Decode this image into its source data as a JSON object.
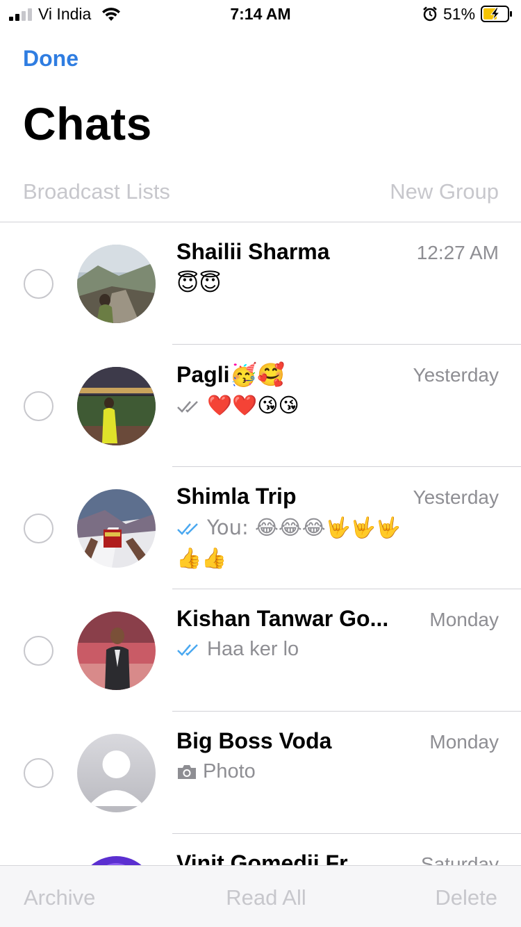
{
  "status_bar": {
    "carrier": "Vi India",
    "time": "7:14 AM",
    "battery_percent": "51%",
    "icons": [
      "signal-icon",
      "wifi-icon",
      "alarm-icon",
      "battery-charging-icon"
    ]
  },
  "header": {
    "done_label": "Done",
    "title": "Chats",
    "broadcast_label": "Broadcast Lists",
    "new_group_label": "New Group",
    "accent_color": "#2f7de1"
  },
  "chats": [
    {
      "name": "Shailii Sharma",
      "time": "12:27 AM",
      "preview": "😇😇",
      "tick": "none"
    },
    {
      "name": "Pagli🥳🥰",
      "time": "Yesterday",
      "preview": "❤️❤️😘😘",
      "tick": "grey"
    },
    {
      "name": "Shimla Trip",
      "time": "Yesterday",
      "preview": "You: 😂😂😂🤟🤟🤟",
      "preview_line2": "👍👍",
      "tick": "blue"
    },
    {
      "name": "Kishan Tanwar Go...",
      "time": "Monday",
      "preview": "Haa ker lo",
      "tick": "blue"
    },
    {
      "name": "Big Boss Voda",
      "time": "Monday",
      "preview": "Photo",
      "tick": "none",
      "icon": "camera-icon"
    },
    {
      "name": "Vinit Gomedii Fr...",
      "time": "Saturday",
      "preview": "",
      "tick": "none"
    }
  ],
  "toolbar": {
    "archive_label": "Archive",
    "read_all_label": "Read All",
    "delete_label": "Delete"
  }
}
